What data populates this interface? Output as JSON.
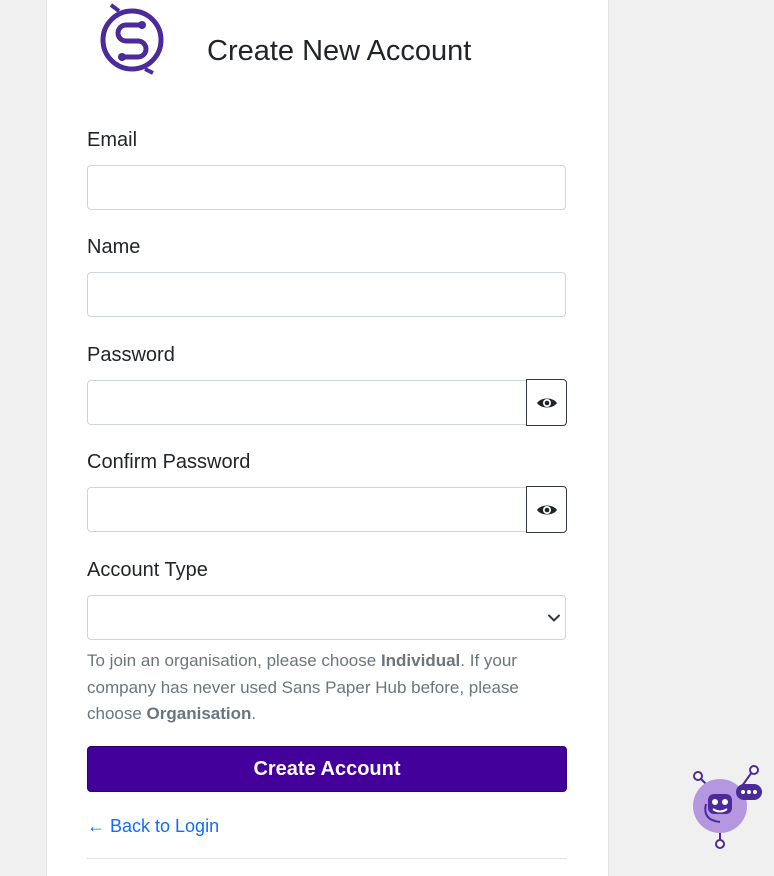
{
  "header": {
    "title": "Create New Account",
    "logo_icon": "sans-paper-hub-logo"
  },
  "form": {
    "email_label": "Email",
    "email_value": "",
    "name_label": "Name",
    "name_value": "",
    "password_label": "Password",
    "password_value": "",
    "confirm_password_label": "Confirm Password",
    "confirm_password_value": "",
    "account_type_label": "Account Type",
    "account_type_value": "",
    "help": {
      "part1": "To join an organisation, please choose ",
      "bold1": "Individual",
      "part2": ". If your company has never used Sans Paper Hub before, please choose ",
      "bold2": "Organisation",
      "part3": "."
    },
    "submit_label": "Create Account",
    "back_link": "← Back to Login"
  },
  "colors": {
    "accent": "#43009a",
    "logo": "#4b2a9a",
    "link": "#0d6efd",
    "bot_bg": "#b497e0"
  }
}
